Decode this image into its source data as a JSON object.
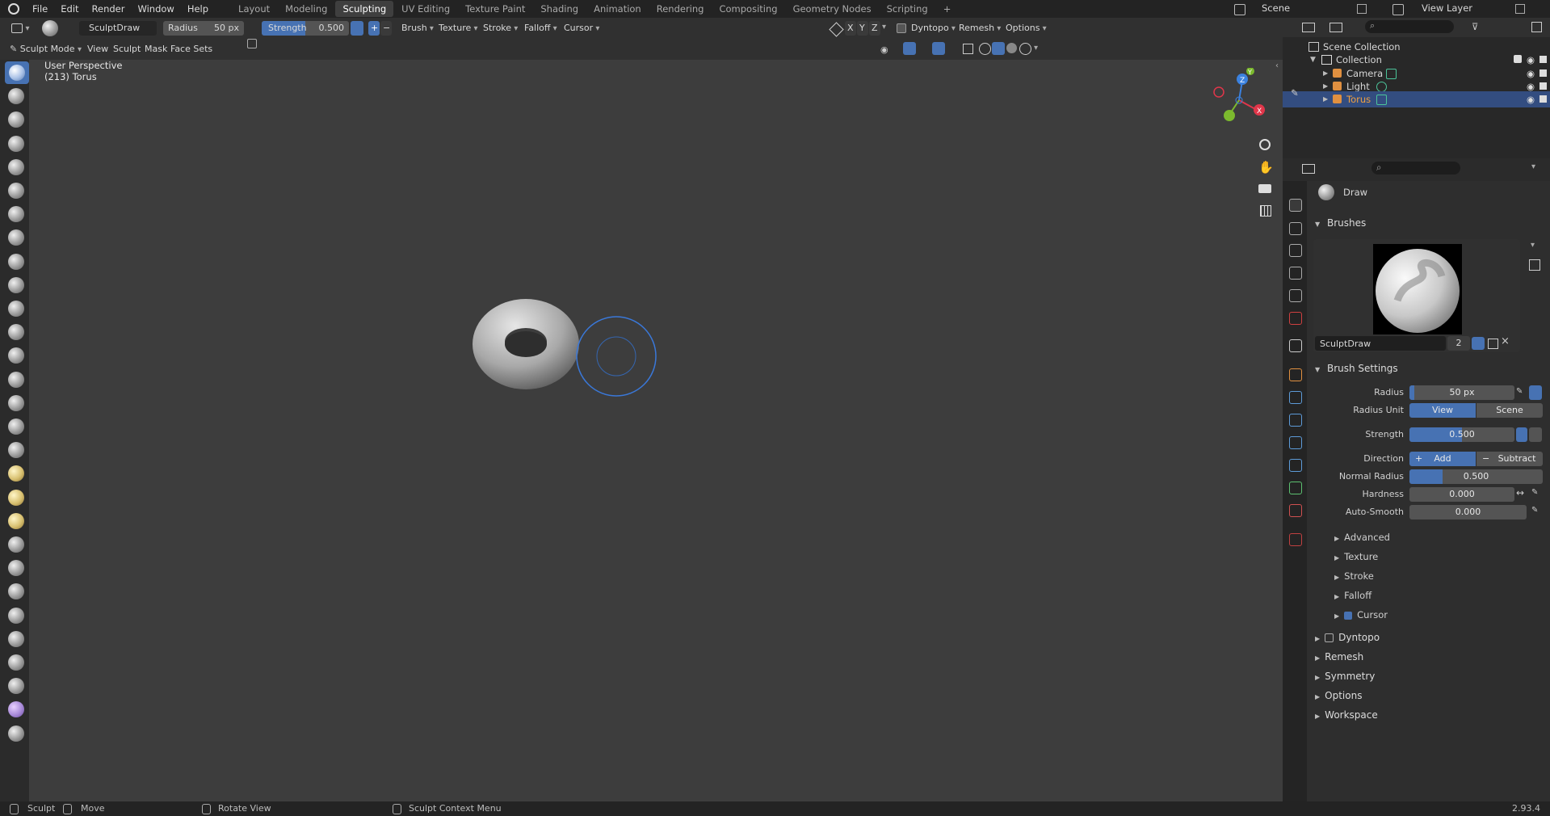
{
  "topbar": {
    "menus": [
      "File",
      "Edit",
      "Render",
      "Window",
      "Help"
    ],
    "workspaces": [
      "Layout",
      "Modeling",
      "Sculpting",
      "UV Editing",
      "Texture Paint",
      "Shading",
      "Animation",
      "Rendering",
      "Compositing",
      "Geometry Nodes",
      "Scripting"
    ],
    "active_workspace": "Sculpting",
    "add_tab": "+",
    "scene": "Scene",
    "view_layer": "View Layer"
  },
  "tool_header": {
    "brush_name": "SculptDraw",
    "radius_label": "Radius",
    "radius_value": "50 px",
    "strength_label": "Strength",
    "strength_value": "0.500",
    "add_sign": "+",
    "sub_sign": "−",
    "menus": [
      "Brush",
      "Texture",
      "Stroke",
      "Falloff",
      "Cursor"
    ],
    "axes": [
      "X",
      "Y",
      "Z"
    ],
    "dyntopo": "Dyntopo",
    "remesh": "Remesh",
    "options": "Options"
  },
  "mode_header": {
    "mode": "Sculpt Mode",
    "menus": [
      "View",
      "Sculpt",
      "Mask",
      "Face Sets"
    ]
  },
  "viewport": {
    "perspective": "User Perspective",
    "object_info": "(213) Torus",
    "gizmo": {
      "x": "X",
      "y": "Y",
      "z": "Z"
    }
  },
  "outliner": {
    "root": "Scene Collection",
    "collection": "Collection",
    "items": [
      {
        "name": "Camera",
        "selected": false
      },
      {
        "name": "Light",
        "selected": false
      },
      {
        "name": "Torus",
        "selected": true
      }
    ]
  },
  "properties": {
    "tool_name": "Draw",
    "brushes_header": "Brushes",
    "brush_name": "SculptDraw",
    "brush_users": "2",
    "brush_settings_header": "Brush Settings",
    "radius_label": "Radius",
    "radius_value": "50 px",
    "radius_unit_label": "Radius Unit",
    "radius_unit_options": [
      "View",
      "Scene"
    ],
    "strength_label": "Strength",
    "strength_value": "0.500",
    "strength_fraction": 0.5,
    "direction_label": "Direction",
    "direction_add": "Add",
    "direction_subtract": "Subtract",
    "normal_radius_label": "Normal Radius",
    "normal_radius_value": "0.500",
    "normal_radius_fraction": 0.25,
    "hardness_label": "Hardness",
    "hardness_value": "0.000",
    "autosmooth_label": "Auto-Smooth",
    "autosmooth_value": "0.000",
    "subpanels": [
      "Advanced",
      "Texture",
      "Stroke",
      "Falloff",
      "Cursor"
    ],
    "sections": [
      "Dyntopo",
      "Remesh",
      "Symmetry",
      "Options",
      "Workspace"
    ]
  },
  "statusbar": {
    "items": [
      "Sculpt",
      "Move",
      "Rotate View",
      "Sculpt Context Menu"
    ],
    "version": "2.93.4"
  },
  "colors": {
    "accent": "#4772b3",
    "selection": "#334d80",
    "x_axis": "#e0364a",
    "y_axis": "#7cba2e",
    "z_axis": "#3b82e0"
  }
}
